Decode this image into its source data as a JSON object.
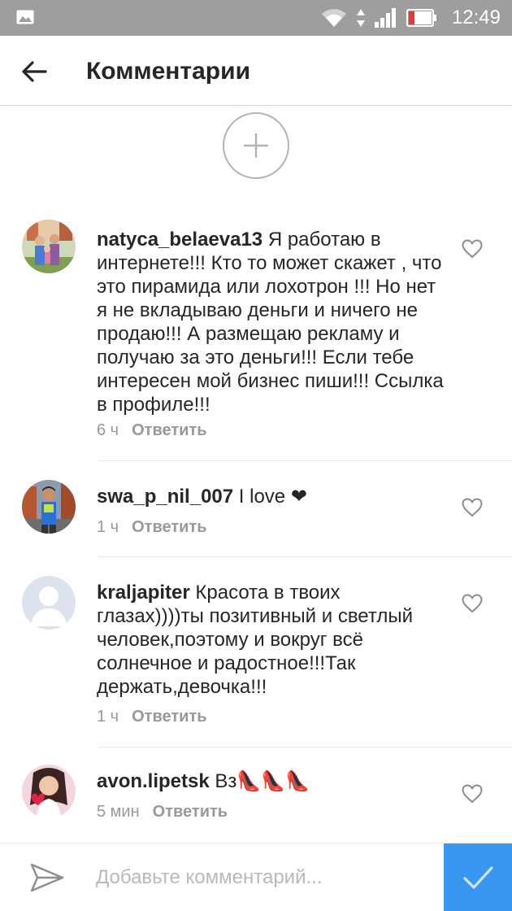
{
  "status_bar": {
    "time": "12:49",
    "icons": [
      "gallery-icon",
      "wifi-icon",
      "data-arrows-icon",
      "signal-icon",
      "battery-low-icon"
    ]
  },
  "header": {
    "title": "Комментарии",
    "back_icon": "arrow-left-icon"
  },
  "load_more_icon": "plus-circle-icon",
  "comments": [
    {
      "username": "natyca_belaeva13",
      "text": "Я работаю в интернете!!! Кто то может скажет , что это пирамида или лохотрон !!! Но нет я не вкладываю деньги и ничего не продаю!!! А размещаю рекламу и получаю за это деньги!!! Если тебе интересен мой бизнес пиши!!! Ссылка в профиле!!!",
      "time": "6 ч",
      "reply": "Ответить"
    },
    {
      "username": "swa_p_nil_007",
      "text": "I love ❤",
      "time": "1 ч",
      "reply": "Ответить"
    },
    {
      "username": "kraljapiter",
      "text": "Красота в твоих глазах))))ты позитивный и светлый человек,поэтому и вокруг всё солнечное и радостное!!!Так держать,девочка!!!",
      "time": "1 ч",
      "reply": "Ответить"
    },
    {
      "username": "avon.lipetsk",
      "text": "Вз👠👠👠",
      "time": "5 мин",
      "reply": "Ответить"
    }
  ],
  "composer": {
    "placeholder": "Добавьте комментарий...",
    "send_icon": "paper-plane-icon",
    "post_icon": "checkmark-icon"
  },
  "colors": {
    "status_bar": "#9e9e9e",
    "accent": "#3897f0",
    "meta_text": "#999999"
  }
}
